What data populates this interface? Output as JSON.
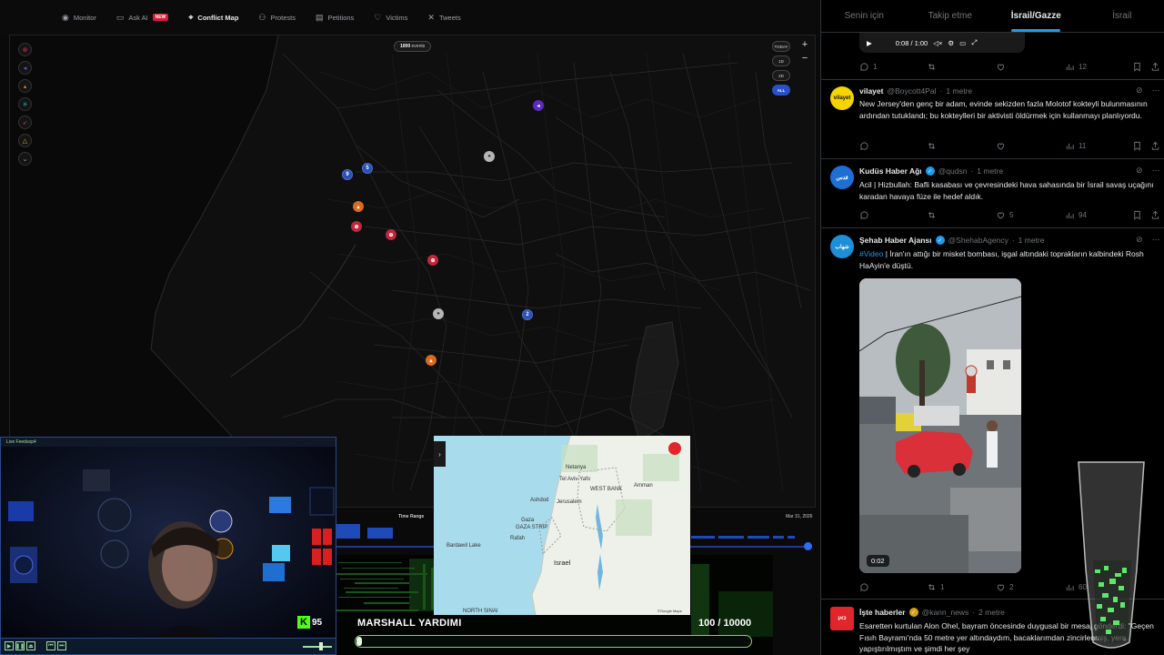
{
  "topnav": {
    "items": [
      {
        "label": "Monitor",
        "icon": "eye-icon"
      },
      {
        "label": "Ask AI",
        "icon": "chat-icon",
        "badge": "NEW"
      },
      {
        "label": "Conflict Map",
        "icon": "map-pin-icon",
        "active": true
      },
      {
        "label": "Protests",
        "icon": "people-icon"
      },
      {
        "label": "Petitions",
        "icon": "document-icon"
      },
      {
        "label": "Victims",
        "icon": "heart-icon"
      },
      {
        "label": "Tweets",
        "icon": "x-icon"
      }
    ]
  },
  "map": {
    "events_count": "1000",
    "events_label": "events",
    "time_filters": [
      "TODAY",
      "1D",
      "2D",
      "ALL"
    ],
    "zoom_in": "+",
    "zoom_out": "−",
    "clusters": [
      "9",
      "5",
      "2"
    ],
    "collapse_arrow": "›"
  },
  "timeline": {
    "label": "Time Range",
    "end_date": "Mar 31, 2026",
    "start_tick": "Mar 31",
    "end_tick": "Mar 31"
  },
  "minimap": {
    "labels": {
      "tel_aviv": "Tel Aviv-Yafo",
      "netanya": "Netanya",
      "west_bank": "WEST BANK",
      "amman": "Amman",
      "ashdod": "Ashdod",
      "jerusalem": "Jerusalem",
      "gaza": "Gaza",
      "gaza_strip": "GAZA STRIP",
      "rafah": "Rafah",
      "israel": "Israel",
      "north_sinai": "NORTH SINAI",
      "bardawil": "Bardawil Lake",
      "google": "©Google Maps"
    }
  },
  "webcam": {
    "title": "Live Feedsop4",
    "kick_count": "95"
  },
  "donation": {
    "title": "MARSHALL YARDIMI",
    "count": "100 / 10000",
    "progress": 0.01
  },
  "feed": {
    "tabs": [
      "Senin için",
      "Takip etme",
      "İsrail/Gazze",
      "İsrail"
    ],
    "active_tab": 2,
    "player": {
      "time": "0:08 / 1:00"
    },
    "top_actions": {
      "reply": "1",
      "retweet": "",
      "like": "",
      "views": "12"
    },
    "tweets": [
      {
        "name": "vilayet",
        "handle": "@Boycott4Pal",
        "time": "1 metre",
        "verified": false,
        "avatar_text": "vilayet",
        "avatar_color": "#f5d400",
        "body": "New Jersey'den genç bir adam, evinde sekizden fazla Molotof kokteyli bulunmasının ardından tutuklandı; bu kokteylleri bir aktivisti öldürmek için kullanmayı planlıyordu.",
        "actions": {
          "reply": "",
          "retweet": "",
          "like": "",
          "views": "11"
        }
      },
      {
        "name": "Kudüs Haber Ağı",
        "handle": "@qudsn",
        "time": "1 metre",
        "verified": true,
        "avatar_text": "قدس",
        "avatar_color": "#1d6fd6",
        "body": "Acil | Hizbullah: Bafli kasabası ve çevresindeki hava sahasında bir İsrail savaş uçağını karadan havaya füze ile hedef aldık.",
        "actions": {
          "reply": "",
          "retweet": "",
          "like": "5",
          "views": "94"
        }
      },
      {
        "name": "Şehab Haber Ajansı",
        "handle": "@ShehabAgency",
        "time": "1 metre",
        "verified": true,
        "avatar_text": "شهاب",
        "avatar_color": "#1d8fd6",
        "tag": "#Video",
        "body": " | İran'ın attığı bir misket bombası, işgal altındaki toprakların kalbindeki Rosh HaAyin'e düştü.",
        "video_time": "0:02",
        "actions": {
          "reply": "",
          "retweet": "1",
          "like": "2",
          "views": "60"
        }
      },
      {
        "name": "İşte haberler",
        "handle": "@kann_news",
        "time": "2 metre",
        "verified": false,
        "avatar_text": "כאן",
        "avatar_color": "#e0262a",
        "body": "Esaretten kurtulan Alon Ohel, bayram öncesinde duygusal bir mesaj gönderdi: \"Geçen Fısıh Bayramı'nda 50 metre yer altındaydım, bacaklarımdan zincirlenmiş, yere yapıştırılmıştım ve şimdi her şey"
      }
    ]
  },
  "colors": {
    "accent": "#1d9bf0",
    "map_cluster": "#2c4fb0",
    "map_red": "#c0263b",
    "map_orange": "#d96b1e",
    "donation_green": "#8acc7a"
  }
}
